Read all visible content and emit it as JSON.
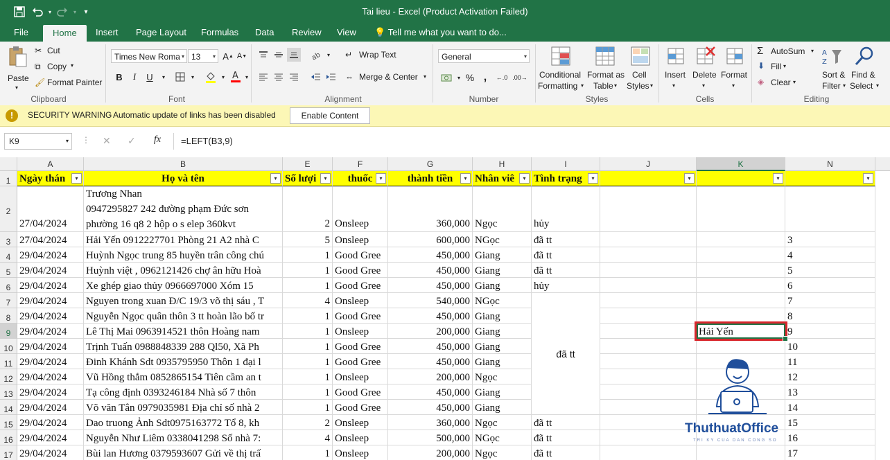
{
  "window": {
    "title": "Tai lieu  -  Excel (Product Activation Failed)"
  },
  "tabs": [
    "File",
    "Home",
    "Insert",
    "Page Layout",
    "Formulas",
    "Data",
    "Review",
    "View"
  ],
  "tell_me": "Tell me what you want to do...",
  "ribbon": {
    "clipboard": {
      "paste": "Paste",
      "cut": "Cut",
      "copy": "Copy",
      "format_painter": "Format Painter",
      "group": "Clipboard"
    },
    "font": {
      "name": "Times New Roma",
      "size": "13",
      "group": "Font"
    },
    "alignment": {
      "wrap_text": "Wrap Text",
      "merge_center": "Merge & Center",
      "group": "Alignment"
    },
    "number": {
      "format": "General",
      "group": "Number"
    },
    "styles": {
      "conditional": "Conditional",
      "formatting": "Formatting",
      "format_as": "Format as",
      "table": "Table",
      "cell": "Cell",
      "cell_styles": "Styles",
      "group": "Styles"
    },
    "cells": {
      "insert": "Insert",
      "delete": "Delete",
      "format": "Format",
      "group": "Cells"
    },
    "editing": {
      "autosum": "AutoSum",
      "fill": "Fill",
      "clear": "Clear",
      "sort": "Sort &",
      "filter": "Filter",
      "find": "Find &",
      "select": "Select",
      "group": "Editing"
    }
  },
  "security": {
    "title": "SECURITY WARNING",
    "message": "Automatic update of links has been disabled",
    "button": "Enable Content"
  },
  "formula_bar": {
    "name_box": "K9",
    "fx": "fx",
    "formula": "=LEFT(B3,9)"
  },
  "columns": [
    "A",
    "B",
    "E",
    "F",
    "G",
    "H",
    "I",
    "J",
    "K",
    "N"
  ],
  "headers": [
    "Ngày thán",
    "Họ và tên",
    "Số lượi",
    "thuốc",
    "thành tiền",
    "Nhân viê",
    "Tình trạng",
    "",
    "",
    ""
  ],
  "row2": {
    "a": "27/04/2024",
    "b1": "Trương Nhan",
    "b2": "0947295827 242 đường phạm Đức sơn",
    "b3": "phường 16 q8 2 hộp o s elep 360kvt",
    "e": "2",
    "f": "Onsleep",
    "g": "360,000",
    "h": "Ngọc",
    "i": "hủy"
  },
  "rows": [
    {
      "n": "3",
      "a": "27/04/2024",
      "b": "Hải Yến 0912227701 Phòng 21 A2 nhà C",
      "e": "5",
      "f": "Onsleep",
      "g": "600,000",
      "h": "NGọc",
      "i": "đã tt"
    },
    {
      "n": "4",
      "a": "29/04/2024",
      "b": "Huỳnh Ngọc trung 85 huyền trân công chú",
      "e": "1",
      "f": "Good Gree",
      "g": "450,000",
      "h": "Giang",
      "i": "đã tt"
    },
    {
      "n": "5",
      "a": "29/04/2024",
      "b": "Huỳnh việt , 0962121426 chợ ân hữu Hoà",
      "e": "1",
      "f": "Good Gree",
      "g": "450,000",
      "h": "Giang",
      "i": "đã tt"
    },
    {
      "n": "6",
      "a": "29/04/2024",
      "b": " Xe ghép giao thủy 0966697000 Xóm 15",
      "e": "1",
      "f": "Good Gree",
      "g": "450,000",
      "h": "Giang",
      "i": "hủy"
    },
    {
      "n": "7",
      "a": "29/04/2024",
      "b": "Nguyen trong xuan Đ/C 19/3 võ thị sáu , T",
      "e": "4",
      "f": "Onsleep",
      "g": "540,000",
      "h": "NGọc",
      "i": ""
    },
    {
      "n": "8",
      "a": "29/04/2024",
      "b": "Nguyễn Ngọc quân thôn 3 tt hoàn lão bố tr",
      "e": "1",
      "f": "Good Gree",
      "g": "450,000",
      "h": "Giang",
      "i": ""
    },
    {
      "n": "9",
      "a": "29/04/2024",
      "b": "Lê Thị Mai 0963914521 thôn Hoàng nam",
      "e": "1",
      "f": "Onsleep",
      "g": "200,000",
      "h": "Giang",
      "i": ""
    },
    {
      "n": "10",
      "a": "29/04/2024",
      "b": "Trịnh Tuấn 0988848339 288 Ql50, Xã Ph",
      "e": "1",
      "f": "Good Gree",
      "g": "450,000",
      "h": "Giang",
      "i": ""
    },
    {
      "n": "11",
      "a": "29/04/2024",
      "b": "Đinh Khánh Sdt 0935795950 Thôn 1 đại l",
      "e": "1",
      "f": "Good Gree",
      "g": "450,000",
      "h": "Giang",
      "i": ""
    },
    {
      "n": "12",
      "a": "29/04/2024",
      "b": "Vũ Hồng thắm 0852865154 Tiên cầm an t",
      "e": "1",
      "f": "Onsleep",
      "g": "200,000",
      "h": "Ngọc",
      "i": ""
    },
    {
      "n": "13",
      "a": "29/04/2024",
      "b": "Tạ công định 0393246184 Nhà số 7 thôn",
      "e": "1",
      "f": "Good Gree",
      "g": "450,000",
      "h": "Giang",
      "i": ""
    },
    {
      "n": "14",
      "a": "29/04/2024",
      "b": " Võ văn Tân 0979035981 Địa chỉ số nhà 2",
      "e": "1",
      "f": "Good Gree",
      "g": "450,000",
      "h": "Giang",
      "i": ""
    },
    {
      "n": "15",
      "a": "29/04/2024",
      "b": "Dao truong Ảnh  Sdt0975163772 Tổ 8, kh",
      "e": "2",
      "f": "Onsleep",
      "g": "360,000",
      "h": "Ngọc",
      "i": "đã tt"
    },
    {
      "n": "16",
      "a": "29/04/2024",
      "b": "Nguyễn Như Liêm 0338041298 Số nhà 7:",
      "e": "4",
      "f": "Onsleep",
      "g": "500,000",
      "h": "NGọc",
      "i": "đã tt"
    },
    {
      "n": "17",
      "a": "29/04/2024",
      "b": "Bùi lan Hương 0379593607 Gửi về thị trấ",
      "e": "1",
      "f": "Onsleep",
      "g": "200,000",
      "h": "Ngọc",
      "i": "đã tt"
    }
  ],
  "merged_status": "đã tt",
  "k9": "Hải Yến",
  "watermark": {
    "brand": "ThuthuatOffice",
    "tagline": "TRI KY CUA DAN CONG SO"
  },
  "colors": {
    "excel_green": "#217346",
    "header_yellow": "#ffff00",
    "selection_red": "#d9262c"
  }
}
